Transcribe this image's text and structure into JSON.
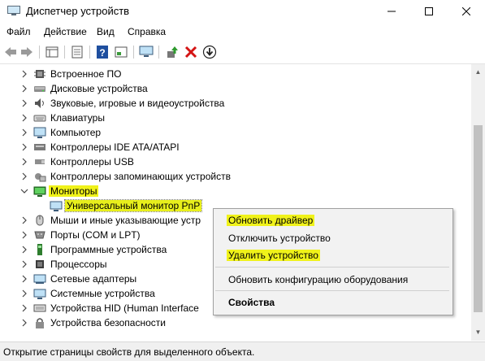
{
  "window": {
    "title": "Диспетчер устройств",
    "minimize_icon": "minimize-icon",
    "maximize_icon": "maximize-icon",
    "close_icon": "close-icon"
  },
  "menu": [
    "Файл",
    "Действие",
    "Вид",
    "Справка"
  ],
  "toolbar_icons": [
    "back-arrow-icon",
    "forward-arrow-icon",
    "properties-grid-icon",
    "device-list-icon",
    "help-icon",
    "action-panel-icon",
    "monitor-scan-icon",
    "update-driver-icon",
    "remove-device-icon",
    "download-icon"
  ],
  "tree": [
    {
      "label": "Встроенное ПО",
      "icon": "firmware-icon",
      "expanded": false
    },
    {
      "label": "Дисковые устройства",
      "icon": "disk-drive-icon",
      "expanded": false
    },
    {
      "label": "Звуковые, игровые и видеоустройства",
      "icon": "speaker-icon",
      "expanded": false
    },
    {
      "label": "Клавиатуры",
      "icon": "keyboard-icon",
      "expanded": false
    },
    {
      "label": "Компьютер",
      "icon": "computer-icon",
      "expanded": false
    },
    {
      "label": "Контроллеры IDE ATA/ATAPI",
      "icon": "ide-controller-icon",
      "expanded": false
    },
    {
      "label": "Контроллеры USB",
      "icon": "usb-icon",
      "expanded": false
    },
    {
      "label": "Контроллеры запоминающих устройств",
      "icon": "storage-controller-icon",
      "expanded": false
    },
    {
      "label": "Мониторы",
      "icon": "monitor-icon",
      "expanded": true,
      "highlighted": true
    },
    {
      "label": "Универсальный монитор PnP",
      "icon": "monitor-icon",
      "child": true,
      "highlighted": true
    },
    {
      "label": "Мыши и иные указывающие устр",
      "icon": "mouse-icon",
      "expanded": false
    },
    {
      "label": "Порты (COM и LPT)",
      "icon": "port-icon",
      "expanded": false
    },
    {
      "label": "Программные устройства",
      "icon": "software-device-icon",
      "expanded": false
    },
    {
      "label": "Процессоры",
      "icon": "processor-icon",
      "expanded": false
    },
    {
      "label": "Сетевые адаптеры",
      "icon": "network-adapter-icon",
      "expanded": false
    },
    {
      "label": "Системные устройства",
      "icon": "system-device-icon",
      "expanded": false
    },
    {
      "label": "Устройства HID (Human Interface",
      "icon": "hid-icon",
      "expanded": false
    },
    {
      "label": "Устройства безопасности",
      "icon": "security-device-icon",
      "expanded": false
    }
  ],
  "context_menu": {
    "update_driver": "Обновить драйвер",
    "disable_device": "Отключить устройство",
    "uninstall_device": "Удалить устройство",
    "scan_hardware": "Обновить конфигурацию оборудования",
    "properties": "Свойства"
  },
  "status_bar": "Открытие страницы свойств для выделенного объекта.",
  "colors": {
    "highlight": "#f0f21a",
    "menu_bg": "#f2f2f2",
    "status_bg": "#f0f0f0"
  }
}
